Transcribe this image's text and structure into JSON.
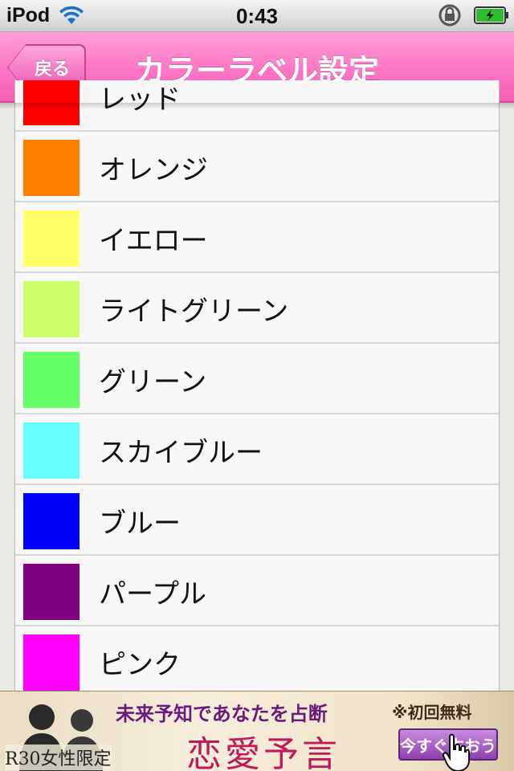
{
  "status_bar": {
    "carrier": "iPod",
    "time": "0:43",
    "icons": [
      "wifi-icon",
      "rotation-lock-icon",
      "battery-charging-icon"
    ]
  },
  "nav": {
    "back_label": "戻る",
    "title": "カラーラベル設定"
  },
  "colors": [
    {
      "label": "レッド",
      "color": "#ff0000"
    },
    {
      "label": "オレンジ",
      "color": "#ff8000"
    },
    {
      "label": "イエロー",
      "color": "#ffff66"
    },
    {
      "label": "ライトグリーン",
      "color": "#ccff66"
    },
    {
      "label": "グリーン",
      "color": "#66ff66"
    },
    {
      "label": "スカイブルー",
      "color": "#66ffff"
    },
    {
      "label": "ブルー",
      "color": "#0000ff"
    },
    {
      "label": "パープル",
      "color": "#800080"
    },
    {
      "label": "ピンク",
      "color": "#ff00ff"
    }
  ],
  "ad": {
    "headline": "未来予知であなたを占断",
    "free_note": "※初回無料",
    "title": "恋愛予言",
    "tag": "R30女性限定",
    "cta": "今すぐ占おう"
  }
}
